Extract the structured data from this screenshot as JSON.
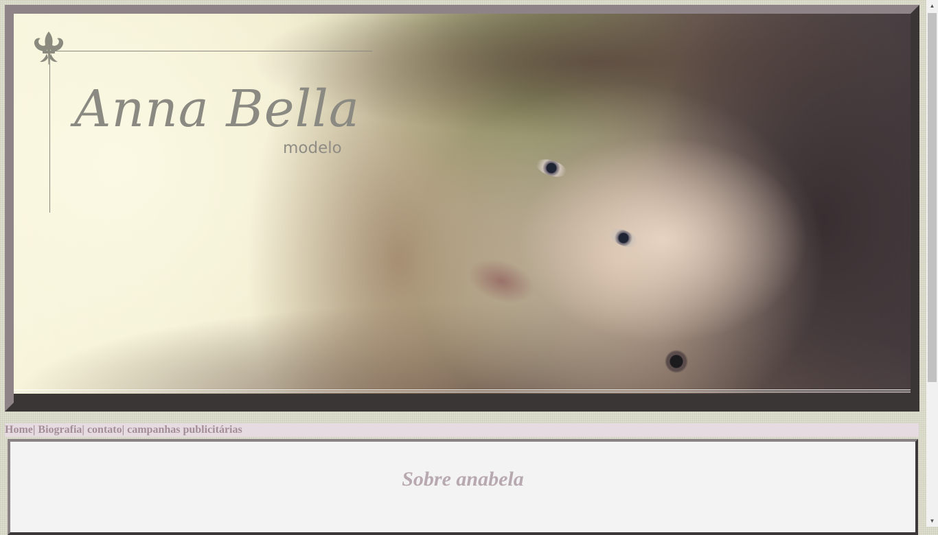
{
  "header": {
    "brand_name": "Anna Bella",
    "brand_subtitle": "modelo",
    "logo_icon": "fleur-de-lis-icon"
  },
  "nav": {
    "items": [
      {
        "label": "Home"
      },
      {
        "label": "Biografia"
      },
      {
        "label": "contato"
      },
      {
        "label": "campanhas publicitárias"
      }
    ],
    "separator": "| "
  },
  "main": {
    "title": "Sobre anabela"
  },
  "scrollbar": {
    "up_icon": "▲",
    "down_icon": "▼"
  },
  "colors": {
    "page_bg": "#d8d9c7",
    "nav_bg": "#e6dbe0",
    "link": "#a38d97",
    "title": "#b8a9b0",
    "frame_dark": "#3a3636",
    "frame_light": "#8e8387"
  }
}
